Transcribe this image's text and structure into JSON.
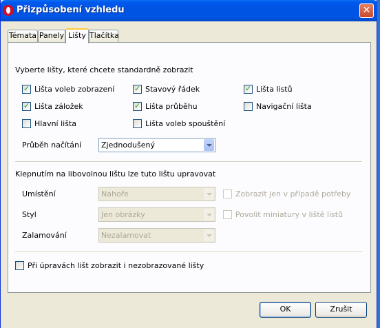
{
  "window": {
    "title": "Přizpůsobení vzhledu",
    "close_symbol": "✕"
  },
  "tabs": [
    {
      "label": "Témata"
    },
    {
      "label": "Panely"
    },
    {
      "label": "Lišty"
    },
    {
      "label": "Tlačítka"
    }
  ],
  "section1": {
    "heading": "Vyberte lišty, které chcete standardně zobrazit",
    "checkboxes": [
      {
        "label": "Lišta voleb zobrazení",
        "checked": true
      },
      {
        "label": "Stavový řádek",
        "checked": true
      },
      {
        "label": "Lišta listů",
        "checked": true
      },
      {
        "label": "Lišta záložek",
        "checked": true
      },
      {
        "label": "Lišta průběhu",
        "checked": true
      },
      {
        "label": "Navigační lišta",
        "checked": false
      },
      {
        "label": "Hlavní lišta",
        "checked": false
      },
      {
        "label": "Lišta voleb spouštění",
        "checked": false
      }
    ],
    "progress_label": "Průběh načítání",
    "progress_value": "Zjednodušený"
  },
  "section2": {
    "heading": "Klepnutím na libovolnou lištu lze tuto lištu upravovat",
    "placement_label": "Umístění",
    "placement_value": "Nahoře",
    "style_label": "Styl",
    "style_value": "Jen obrázky",
    "wrap_label": "Zalamování",
    "wrap_value": "Nezalamovat",
    "show_if_needed": "Zobrazit jen v případě potřeby",
    "allow_thumbnails": "Povolit miniatury v liště listů"
  },
  "bottom_checkbox": {
    "label": "Při úpravách lišt zobrazit i nezobrazované lišty",
    "checked": false
  },
  "buttons": {
    "ok": "OK",
    "cancel": "Zrušit"
  }
}
